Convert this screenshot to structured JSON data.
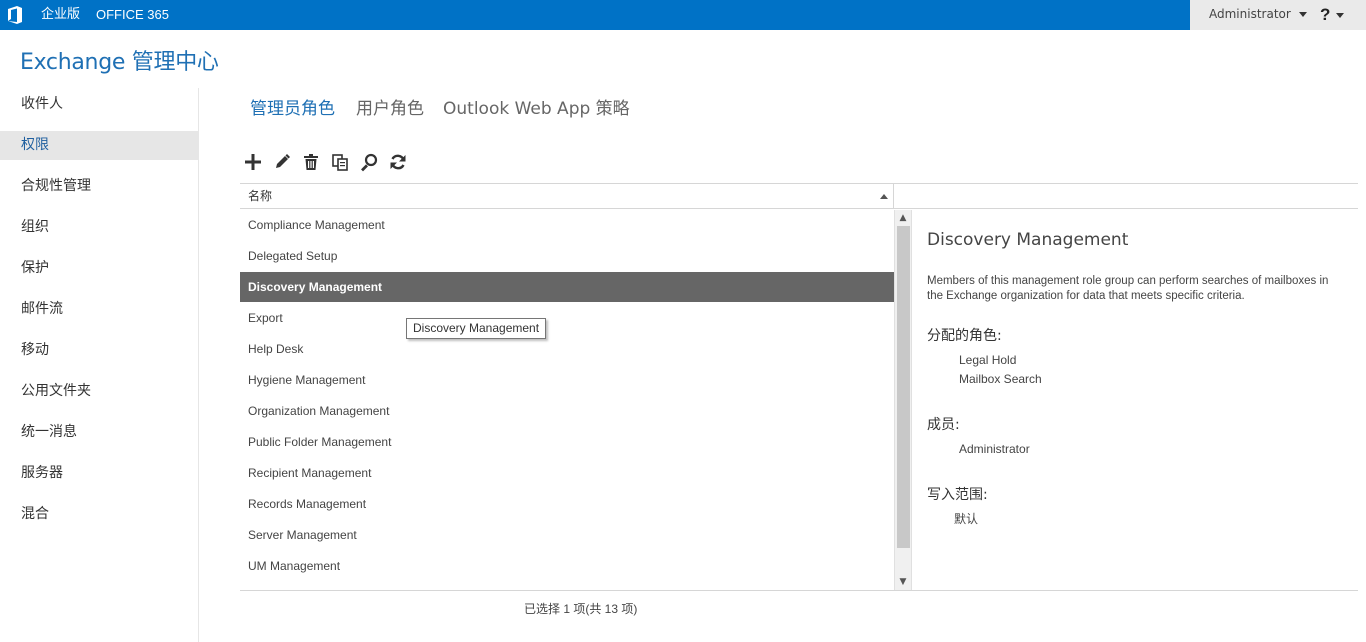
{
  "topbar": {
    "edition": "企业版",
    "office365": "OFFICE 365",
    "user": "Administrator",
    "help": "?",
    "colors": {
      "bar": "#0072c6",
      "right_panel": "#eaeaea"
    }
  },
  "app": {
    "title": "Exchange 管理中心"
  },
  "sidebar": {
    "items": [
      {
        "label": "收件人",
        "active": false
      },
      {
        "label": "权限",
        "active": true
      },
      {
        "label": "合规性管理",
        "active": false
      },
      {
        "label": "组织",
        "active": false
      },
      {
        "label": "保护",
        "active": false
      },
      {
        "label": "邮件流",
        "active": false
      },
      {
        "label": "移动",
        "active": false
      },
      {
        "label": "公用文件夹",
        "active": false
      },
      {
        "label": "统一消息",
        "active": false
      },
      {
        "label": "服务器",
        "active": false
      },
      {
        "label": "混合",
        "active": false
      }
    ]
  },
  "tabs": [
    {
      "label": "管理员角色",
      "active": true
    },
    {
      "label": "用户角色",
      "active": false
    },
    {
      "label": "Outlook Web App 策略",
      "active": false
    }
  ],
  "toolbar": {
    "icons": [
      "add-icon",
      "edit-icon",
      "delete-icon",
      "copy-icon",
      "search-icon",
      "refresh-icon"
    ]
  },
  "list": {
    "column_header": "名称",
    "sort": "ascending",
    "rows": [
      {
        "name": "Compliance Management",
        "selected": false
      },
      {
        "name": "Delegated Setup",
        "selected": false
      },
      {
        "name": "Discovery Management",
        "selected": true
      },
      {
        "name": "Export",
        "selected": false
      },
      {
        "name": "Help Desk",
        "selected": false
      },
      {
        "name": "Hygiene Management",
        "selected": false
      },
      {
        "name": "Organization Management",
        "selected": false
      },
      {
        "name": "Public Folder Management",
        "selected": false
      },
      {
        "name": "Recipient Management",
        "selected": false
      },
      {
        "name": "Records Management",
        "selected": false
      },
      {
        "name": "Server Management",
        "selected": false
      },
      {
        "name": "UM Management",
        "selected": false
      }
    ],
    "status": "已选择 1 项(共 13 项)",
    "tooltip": "Discovery Management"
  },
  "details": {
    "title": "Discovery Management",
    "description": "Members of this management role group can perform searches of mailboxes in the Exchange organization for data that meets specific criteria.",
    "assigned_roles_label": "分配的角色:",
    "assigned_roles": [
      "Legal Hold",
      "Mailbox Search"
    ],
    "members_label": "成员:",
    "members": [
      "Administrator"
    ],
    "write_scope_label": "写入范围:",
    "write_scope": "默认"
  }
}
